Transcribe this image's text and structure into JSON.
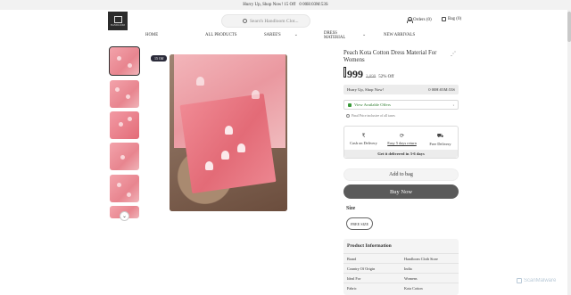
{
  "topbar": {
    "text": "Hurry Up, Shop Now!  15 Off",
    "timer": "0 00H:03M:53S"
  },
  "header": {
    "logo_text": "HANDLOOM",
    "search_placeholder": "Search Handloom Clot...",
    "orders_label": "Orders (0)",
    "bag_label": "Bag (0)"
  },
  "nav": {
    "items": [
      {
        "label": "HOME"
      },
      {
        "label": "ALL PRODUCTS"
      },
      {
        "label": "SAREE'S"
      },
      {
        "label": "DRESS MATERIAL"
      },
      {
        "label": "NEW ARRIVALS"
      }
    ]
  },
  "gallery": {
    "badge": "15 Off",
    "thumb_count": 6
  },
  "product": {
    "title": "Peach Kota Cotton Dress Material For Womens",
    "price": "999",
    "mrp": "2,099",
    "discount": "52% Off",
    "hurry_text": "Hurry Up, Shop Now!",
    "hurry_timer": "0 00H:03M:53S",
    "offers_label": "View Available Offers",
    "offers_chevron": "›",
    "tax_note": "Final Price inclusive of all taxes",
    "delivery": [
      {
        "icon": "₹",
        "label": "Cash on Delivery"
      },
      {
        "icon": "⟳",
        "label": "Easy 5 days return"
      },
      {
        "icon": "⛟",
        "label": "Free Delivery"
      }
    ],
    "delivery_note": "Get it delivered in 3-6 days",
    "add_to_bag": "Add to bag",
    "buy_now": "Buy Now",
    "size_label": "Size",
    "size_value": "FREE SIZE"
  },
  "product_info": {
    "title": "Product Information",
    "rows": [
      {
        "key": "Brand",
        "value": "Handloom Cloth Store"
      },
      {
        "key": "Country Of Origin",
        "value": "India"
      },
      {
        "key": "Ideal For",
        "value": "Womens"
      },
      {
        "key": "Fabric",
        "value": "Kota Cotton"
      }
    ]
  },
  "watermark": "ScanMalware"
}
